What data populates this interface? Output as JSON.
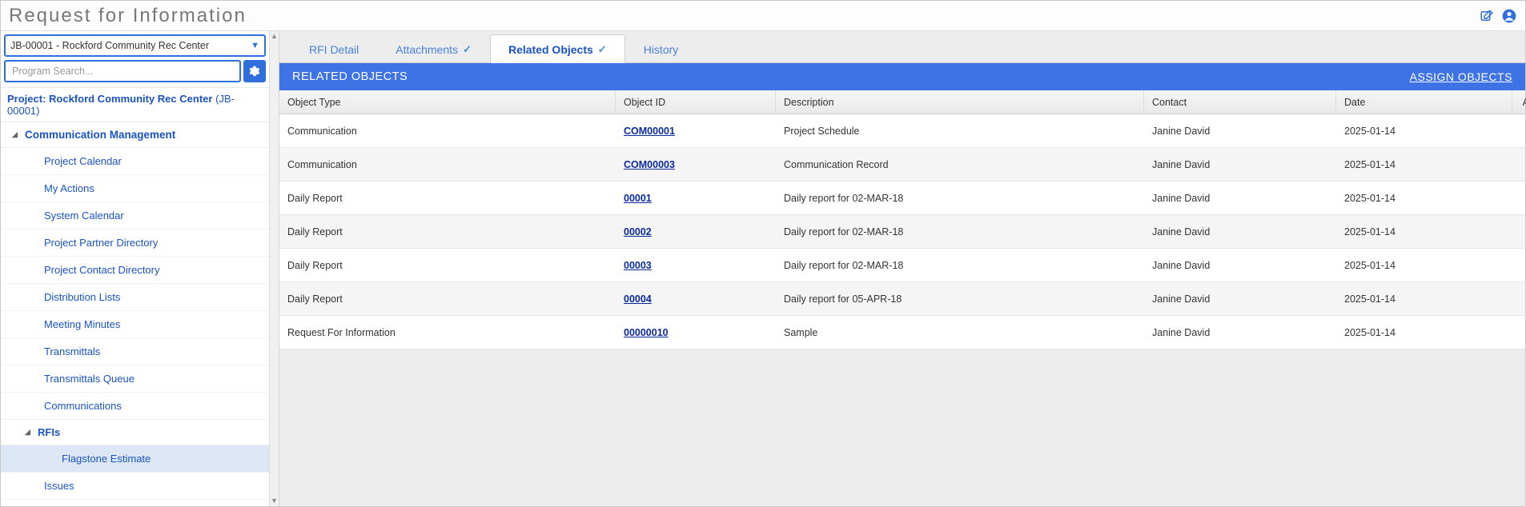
{
  "title": "Request for Information",
  "sidebar": {
    "project_select": "JB-00001 - Rockford Community Rec Center",
    "search_placeholder": "Program Search...",
    "project_link_prefix": "Project: Rockford Community Rec Center",
    "project_link_suffix": "(JB-00001)",
    "group_label": "Communication Management",
    "items": [
      "Project Calendar",
      "My Actions",
      "System Calendar",
      "Project Partner Directory",
      "Project Contact Directory",
      "Distribution Lists",
      "Meeting Minutes",
      "Transmittals",
      "Transmittals Queue",
      "Communications"
    ],
    "rfis_label": "RFIs",
    "rfi_child": "Flagstone Estimate",
    "issues_label": "Issues"
  },
  "tabs": {
    "detail": "RFI Detail",
    "attachments": "Attachments",
    "related": "Related Objects",
    "history": "History"
  },
  "panel": {
    "title": "RELATED OBJECTS",
    "assign": "ASSIGN OBJECTS"
  },
  "columns": {
    "type": "Object Type",
    "id": "Object ID",
    "desc": "Description",
    "contact": "Contact",
    "date": "Date",
    "action": "Action"
  },
  "rows": [
    {
      "type": "Communication",
      "id": "COM00001",
      "desc": "Project Schedule",
      "contact": "Janine David",
      "date": "2025-01-14"
    },
    {
      "type": "Communication",
      "id": "COM00003",
      "desc": "Communication Record",
      "contact": "Janine David",
      "date": "2025-01-14"
    },
    {
      "type": "Daily Report",
      "id": "00001",
      "desc": "Daily report for 02-MAR-18",
      "contact": "Janine David",
      "date": "2025-01-14"
    },
    {
      "type": "Daily Report",
      "id": "00002",
      "desc": "Daily report for 02-MAR-18",
      "contact": "Janine David",
      "date": "2025-01-14"
    },
    {
      "type": "Daily Report",
      "id": "00003",
      "desc": "Daily report for 02-MAR-18",
      "contact": "Janine David",
      "date": "2025-01-14"
    },
    {
      "type": "Daily Report",
      "id": "00004",
      "desc": "Daily report for 05-APR-18",
      "contact": "Janine David",
      "date": "2025-01-14"
    },
    {
      "type": "Request For Information",
      "id": "00000010",
      "desc": "Sample",
      "contact": "Janine David",
      "date": "2025-01-14"
    }
  ]
}
